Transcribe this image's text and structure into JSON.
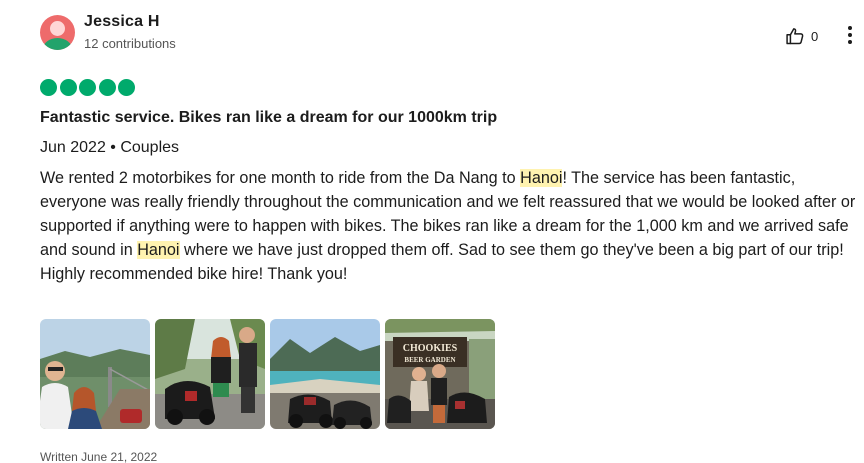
{
  "reviewer": {
    "name": "Jessica H",
    "contributions": "12 contributions"
  },
  "helpful": {
    "count": "0",
    "icon": "thumbs-up-icon"
  },
  "rating": {
    "value": 5,
    "max": 5,
    "color": "#00aa6c"
  },
  "review": {
    "title": "Fantastic service. Bikes ran like a dream for our 1000km trip",
    "meta": "Jun 2022 • Couples",
    "text": [
      {
        "t": "We rented 2 motorbikes for one month to ride from the Da Nang to "
      },
      {
        "t": "Hanoi",
        "hl": true
      },
      {
        "t": "! The service has been fantastic, everyone was really friendly throughout the communication and we felt reassured that we would be looked after or supported if anything were to happen with bikes. The bikes ran like a dream for the 1,000 km and we arrived safe and sound in "
      },
      {
        "t": "Hanoi",
        "hl": true
      },
      {
        "t": " where we have just dropped them off. Sad to see them go they've been a big part of our trip! Highly recommended bike hire! Thank you!"
      }
    ],
    "highlight_color": "#fff3b0"
  },
  "photos": [
    {
      "name": "photo-couple-bridge-selfie"
    },
    {
      "name": "photo-couple-with-motorbikes"
    },
    {
      "name": "photo-coastal-view-with-bikes"
    },
    {
      "name": "photo-chookies-beer-garden",
      "sign_line1": "CHOOKIES",
      "sign_line2": "BEER GARDEN"
    }
  ],
  "written": "Written June 21, 2022"
}
